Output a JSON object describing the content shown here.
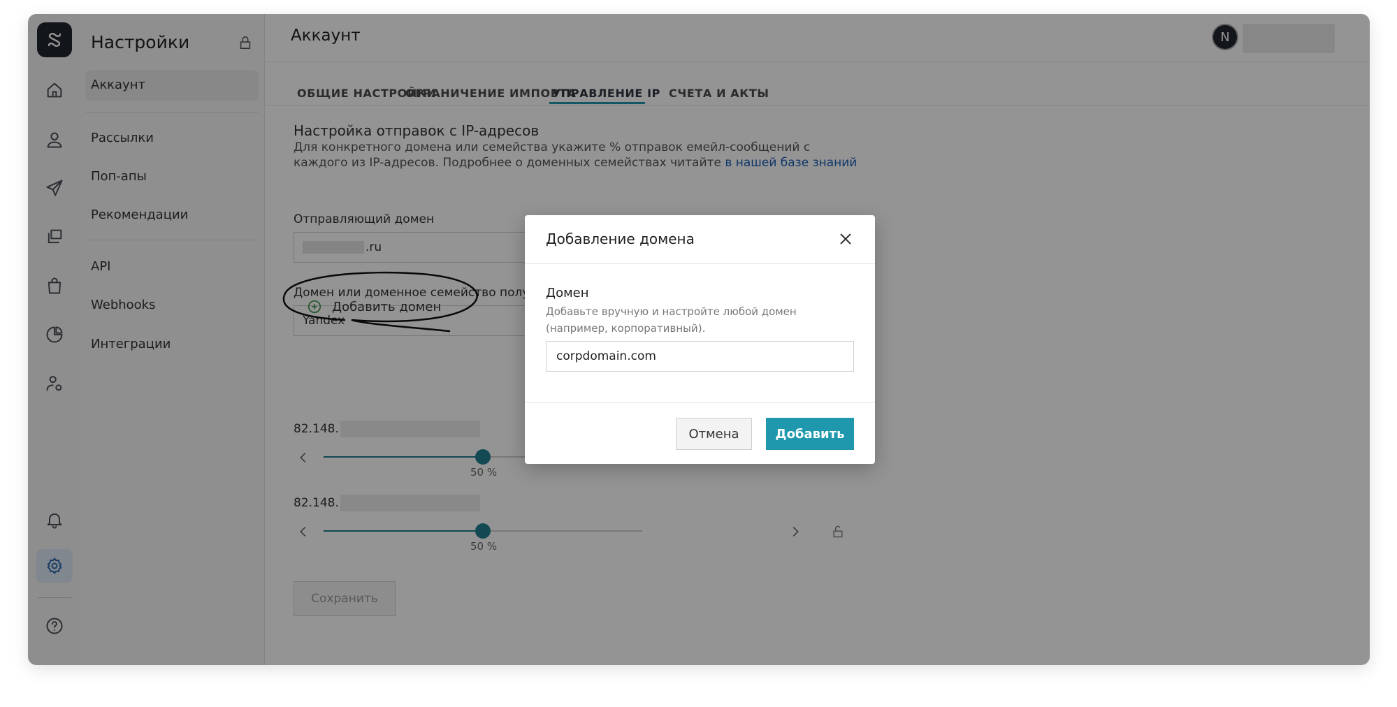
{
  "sidebar": {
    "title": "Настройки",
    "items": [
      {
        "label": "Аккаунт"
      },
      {
        "label": "Рассылки"
      },
      {
        "label": "Поп-апы"
      },
      {
        "label": "Рекомендации"
      },
      {
        "label": "API"
      },
      {
        "label": "Webhooks"
      },
      {
        "label": "Интеграции"
      }
    ]
  },
  "header": {
    "title": "Аккаунт",
    "avatar_initial": "N"
  },
  "tabs": [
    {
      "label": "ОБЩИЕ НАСТРОЙКИ"
    },
    {
      "label": "ОГРАНИЧЕНИЕ ИМПОРТА"
    },
    {
      "label": "УПРАВЛЕНИЕ IP",
      "active": true
    },
    {
      "label": "СЧЕТА И АКТЫ"
    }
  ],
  "section": {
    "title": "Настройка отправок с IP-адресов",
    "description": "Для конкретного домена или семейства укажите % отправок емейл-сообщений с каждого из IP-адресов. Подробнее о доменных семействах читайте ",
    "link_text": "в нашей базе знаний"
  },
  "form": {
    "sender_label": "Отправляющий домен",
    "sender_value_suffix": ".ru",
    "recipient_label": "Домен или доменное семейство полу",
    "recipient_value": "Yandex",
    "add_domain_label": "Добавить домен",
    "save_label": "Сохранить"
  },
  "ips": [
    {
      "prefix": "82.148.",
      "percent_label": "50 %",
      "value": 0.5
    },
    {
      "prefix": "82.148.",
      "percent_label": "50 %",
      "value": 0.5
    }
  ],
  "modal": {
    "title": "Добавление домена",
    "field_label": "Домен",
    "hint": "Добавьте вручную и настройте любой домен (например, корпоративный).",
    "input_value": "corpdomain.com",
    "cancel_label": "Отмена",
    "add_label": "Добавить"
  },
  "colors": {
    "accent": "#1f98ad",
    "slider": "#1f7f90",
    "link": "#1a5fb4"
  }
}
